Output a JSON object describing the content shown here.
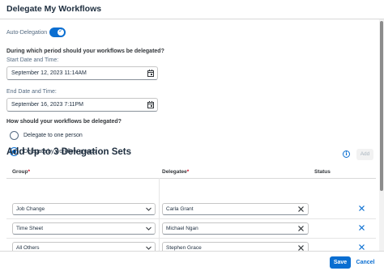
{
  "dialog": {
    "title": "Delegate My Workflows"
  },
  "auto_delegation": {
    "label": "Auto-Delegation",
    "enabled": true
  },
  "period": {
    "question": "During which period should your workflows be delegated?",
    "start_label": "Start Date and Time:",
    "start_value": "September 12, 2023 11:14AM",
    "end_label": "End Date and Time:",
    "end_value": "September 16, 2023 7:11PM"
  },
  "method": {
    "question": "How should your workflows be delegated?",
    "options": [
      {
        "label": "Delegate to one person",
        "selected": false
      },
      {
        "label": "Delegate by workflow groups",
        "selected": true
      }
    ]
  },
  "delegation_sets": {
    "title": "Add Up to 3 Delegation Sets",
    "add_label": "Add",
    "columns": {
      "group": "Group",
      "delegatee": "Delegatee",
      "status": "Status",
      "required_marker": "*"
    },
    "rows": [
      {
        "group": "Job Change",
        "delegatee": "Carla Grant"
      },
      {
        "group": "Time Sheet",
        "delegatee": "Michael Ngan"
      },
      {
        "group": "All Others",
        "delegatee": "Stephen Grace"
      }
    ]
  },
  "footer": {
    "save_label": "Save",
    "cancel_label": "Cancel"
  },
  "colors": {
    "accent": "#0a6ed1",
    "text": "#1d2d3e",
    "required": "#d0021b"
  }
}
